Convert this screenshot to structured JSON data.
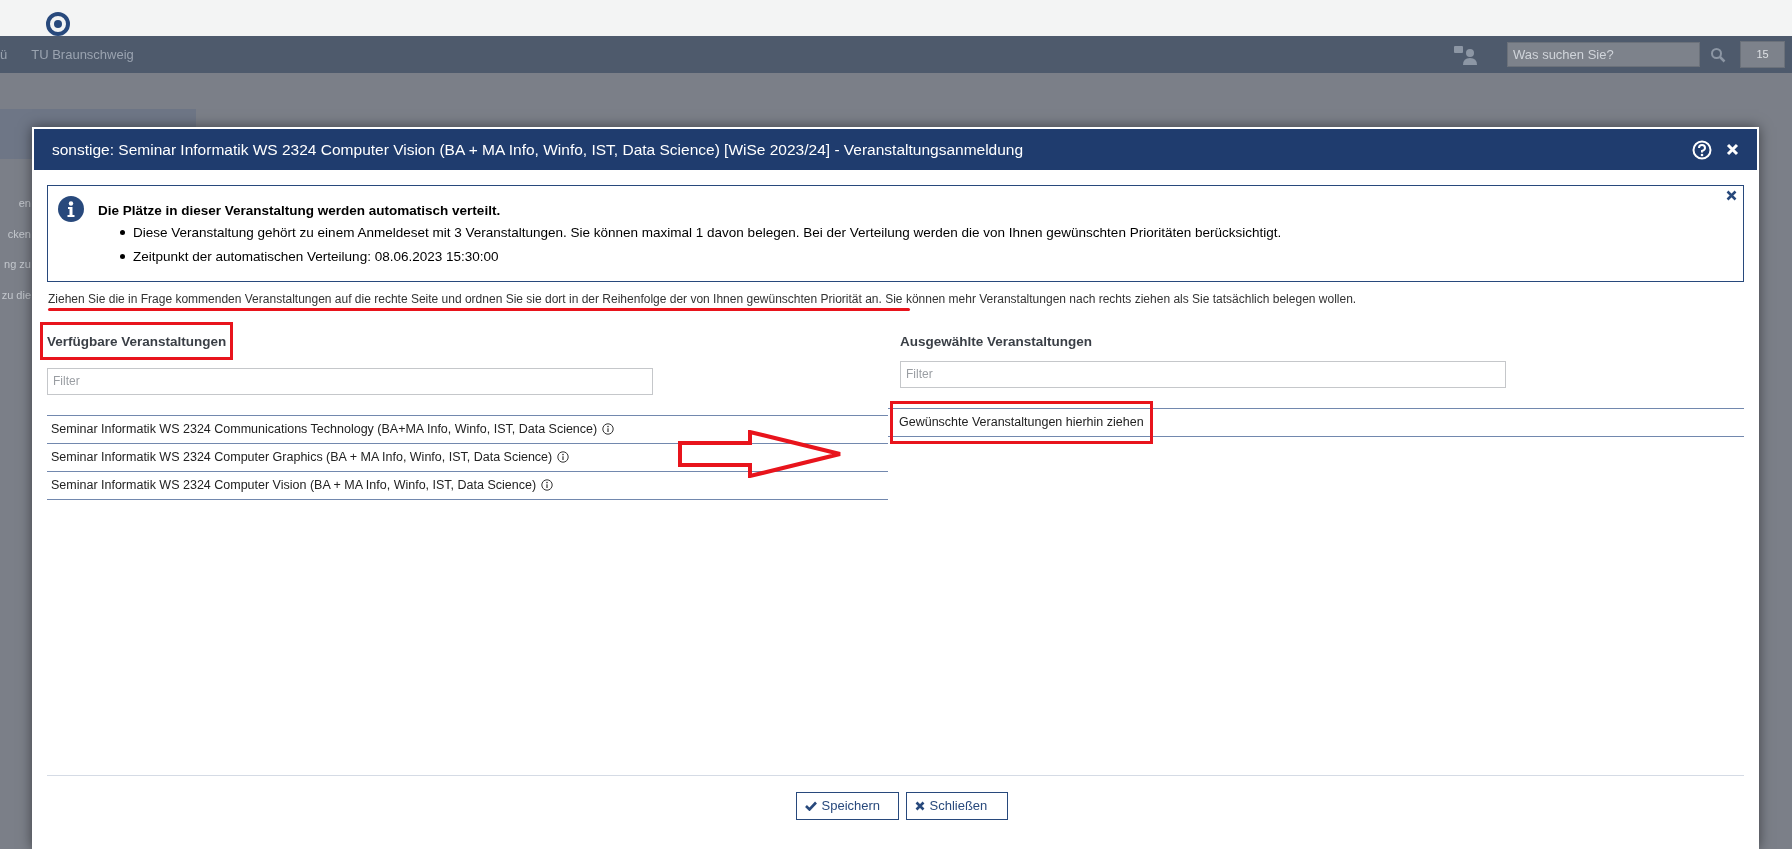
{
  "background": {
    "menu_fragment": "ü",
    "site_name": "TU Braunschweig",
    "search": {
      "placeholder": "Was suchen Sie?"
    },
    "counter": "15",
    "sidebar_fragments": [
      "en",
      "cken",
      "ng zu",
      "zu die"
    ]
  },
  "dialog": {
    "title": "sonstige: Seminar Informatik WS 2324 Computer Vision (BA + MA Info, Winfo, IST, Data Science) [WiSe 2023/24] - Veranstaltungsanmeldung",
    "info": {
      "heading": "Die Plätze in dieser Veranstaltung werden automatisch verteilt.",
      "bullets": [
        "Diese Veranstaltung gehört zu einem Anmeldeset mit 3 Veranstaltungen. Sie können maximal 1 davon belegen. Bei der Verteilung werden die von Ihnen gewünschten Prioritäten berücksichtigt.",
        "Zeitpunkt der automatischen Verteilung: 08.06.2023 15:30:00"
      ]
    },
    "instruction": "Ziehen Sie die in Frage kommenden Veranstaltungen auf die rechte Seite und ordnen Sie sie dort in der Reihenfolge der von Ihnen gewünschten Priorität an. Sie können mehr Veranstaltungen nach rechts ziehen als Sie tatsächlich belegen wollen.",
    "available": {
      "heading": "Verfügbare Veranstaltungen",
      "filter": {
        "placeholder": "Filter"
      },
      "items": [
        "Seminar Informatik WS 2324 Communications Technology (BA+MA Info, Winfo, IST, Data Science)",
        "Seminar Informatik WS 2324 Computer Graphics (BA + MA Info, Winfo, IST, Data Science)",
        "Seminar Informatik WS 2324 Computer Vision (BA + MA Info, Winfo, IST, Data Science)"
      ]
    },
    "selected": {
      "heading": "Ausgewählte Veranstaltungen",
      "filter": {
        "placeholder": "Filter"
      },
      "drop_hint": "Gewünschte Veranstaltungen hierhin ziehen"
    },
    "buttons": [
      {
        "label": "Speichern",
        "kind": "save"
      },
      {
        "label": "Schließen",
        "kind": "close"
      }
    ]
  }
}
